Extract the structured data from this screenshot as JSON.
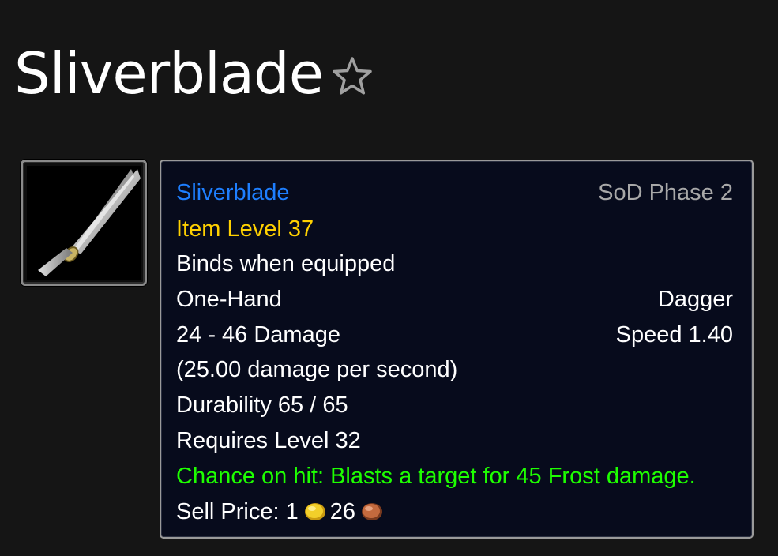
{
  "page": {
    "title": "Sliverblade",
    "favorite_icon": "star-outline-icon"
  },
  "item_icon": "dagger-icon",
  "tooltip": {
    "name": "Sliverblade",
    "phase": "SoD Phase 2",
    "item_level": "Item Level 37",
    "binds": "Binds when equipped",
    "slot": "One-Hand",
    "type": "Dagger",
    "damage": "24 - 46 Damage",
    "speed": "Speed 1.40",
    "dps": "(25.00 damage per second)",
    "durability": "Durability 65 / 65",
    "requires": "Requires Level 32",
    "proc": "Chance on hit: Blasts a target for 45 Frost damage.",
    "sell_price_label": "Sell Price:",
    "sell_gold": "1",
    "sell_silver": "26",
    "gold_icon": "gold-coin-icon",
    "silver_icon": "copper-coin-icon"
  },
  "colors": {
    "item_name": "#1e7fff",
    "item_level": "#ffd100",
    "proc": "#1eff00",
    "phase": "#a8a8a8",
    "tooltip_bg": "#070b1c"
  }
}
